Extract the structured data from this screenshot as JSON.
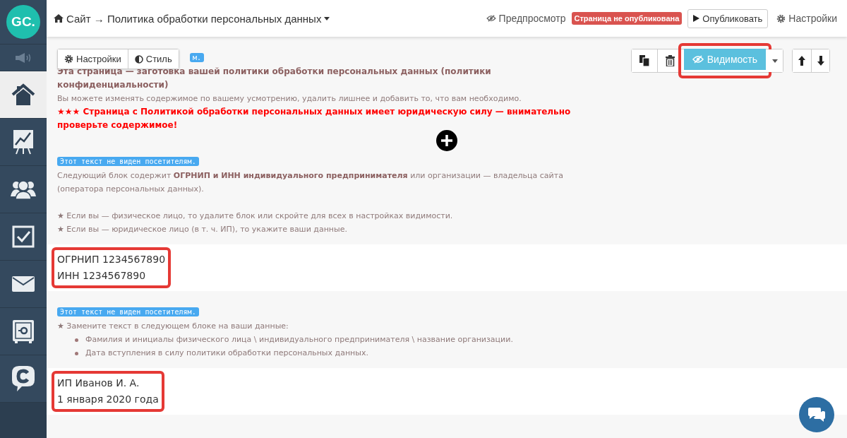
{
  "sidebar": {
    "logo": "GC.",
    "items": [
      {
        "kind": "speaker",
        "selected": false
      },
      {
        "kind": "home",
        "selected": true
      },
      {
        "kind": "chart",
        "selected": false
      },
      {
        "kind": "users",
        "selected": false
      },
      {
        "kind": "tasks",
        "selected": false
      },
      {
        "kind": "mail",
        "selected": false
      },
      {
        "kind": "safe",
        "selected": false
      },
      {
        "kind": "chat",
        "selected": false
      }
    ]
  },
  "topbar": {
    "breadcrumb": "Сайт → Политика обработки персональных данных",
    "preview": "Предпросмотр",
    "status_badge": "Страница не опубликована",
    "publish_button": "Опубликовать",
    "settings": "Настройки"
  },
  "block_toolbar": [
    {
      "kind": "gear",
      "label": "Настройки"
    },
    {
      "kind": "contrast",
      "label": "Стиль"
    }
  ],
  "block_actions": {
    "visibility_button": "Видимость",
    "highlighted": true
  },
  "blocks": [
    {
      "kind": "note",
      "badge": "м.",
      "paragraphs": [
        {
          "kind": "bold",
          "text": "Эта страница — заготовка вашей политики обработки персональных данных (политики конфиденциальности)"
        },
        {
          "kind": "plain",
          "text": "Вы можете изменять содержимое по вашему усмотрению, удалить лишнее и добавить то, что вам необходимо."
        },
        {
          "kind": "alert",
          "text": "★★★ Страница с Политикой обработки персональных данных имеет юридическую силу — внимательно проверьте содержимое!"
        }
      ]
    },
    {
      "kind": "note",
      "badge": "Этот текст не виден посетителям.",
      "paragraphs": [
        {
          "kind": "plain",
          "text": "Следующий блок содержит **ОГРНИП и ИНН индивидуального предпринимателя** или организации — владельца сайта (оператора персональных данных)."
        },
        {
          "kind": "gap"
        },
        {
          "kind": "plain",
          "text": "★ Если вы — физическое лицо, то удалите блок или скройте для всех в настройках видимости."
        },
        {
          "kind": "plain",
          "text": "★ Если вы — юридическое лицо (в т. ч. ИП), то укажите ваши данные."
        }
      ]
    },
    {
      "kind": "content",
      "highlighted": true,
      "lines": [
        "ОГРНИП 1234567890",
        "ИНН 1234567890"
      ]
    },
    {
      "kind": "note",
      "badge": "Этот текст не виден посетителям.",
      "paragraphs": [
        {
          "kind": "plain",
          "text": "★ Замените текст в следующем блоке на ваши данные:"
        },
        {
          "kind": "bullet",
          "text": "Фамилия и инициалы физического лица \\ индивидуального предпринимателя \\ название организации."
        },
        {
          "kind": "bullet",
          "text": "Дата вступления в силу политики обработки персональных данных."
        }
      ]
    },
    {
      "kind": "content",
      "highlighted": true,
      "lines": [
        "ИП Иванов И. А.",
        "1 января 2020 года"
      ]
    }
  ]
}
